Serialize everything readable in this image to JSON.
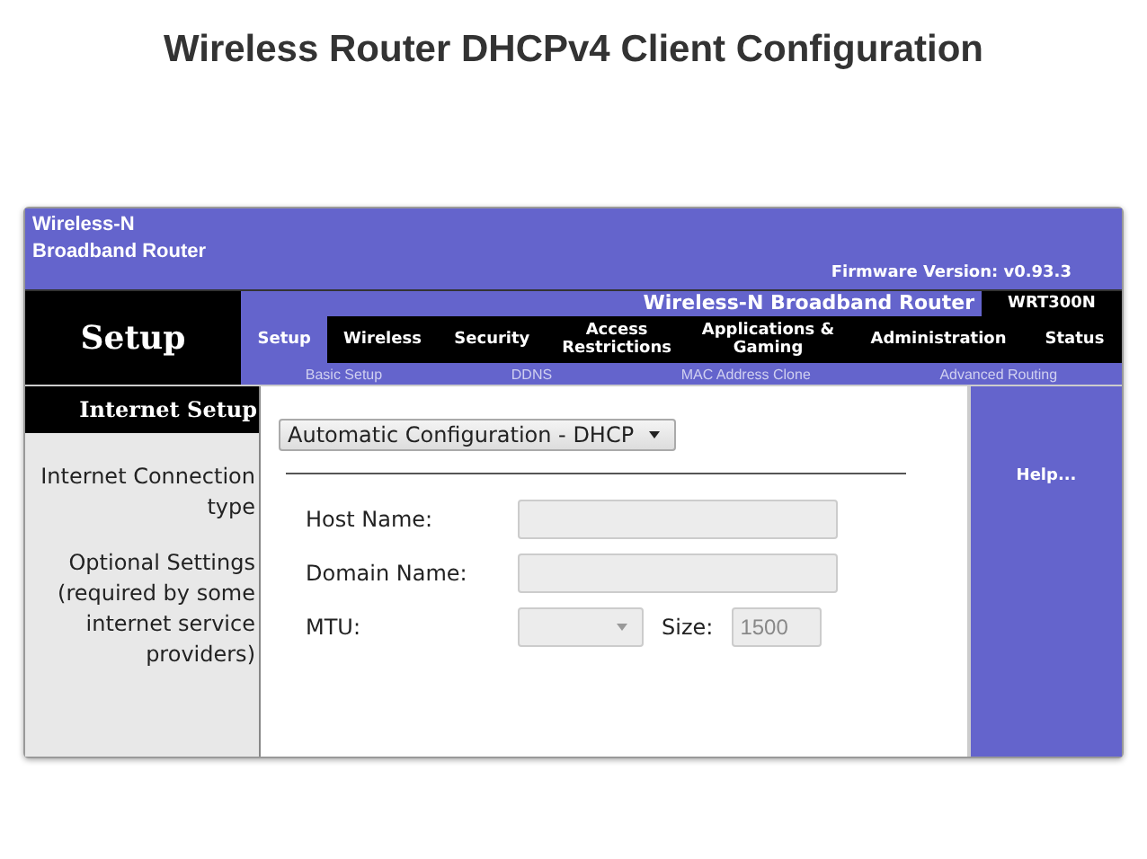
{
  "page_title": "Wireless Router DHCPv4 Client Configuration",
  "router": {
    "brand_lines": [
      "Wireless-N",
      "Broadband Router"
    ],
    "firmware": "Firmware Version: v0.93.3",
    "section": "Setup",
    "product_name": "Wireless-N Broadband Router",
    "model": "WRT300N",
    "tabs": [
      {
        "label": "Setup",
        "selected": true
      },
      {
        "label": "Wireless",
        "selected": false
      },
      {
        "label": "Security",
        "selected": false
      },
      {
        "label": "Access Restrictions",
        "selected": false
      },
      {
        "label": "Applications & Gaming",
        "selected": false
      },
      {
        "label": "Administration",
        "selected": false
      },
      {
        "label": "Status",
        "selected": false
      }
    ],
    "subtabs": [
      "Basic Setup",
      "DDNS",
      "MAC Address Clone",
      "Advanced Routing"
    ],
    "sidebar": {
      "heading": "Internet Setup",
      "labels": [
        "Internet Connection type",
        "Optional Settings (required by some internet service providers)"
      ]
    },
    "connection_type": "Automatic Configuration - DHCP",
    "fields": [
      {
        "label": "Host Name:",
        "kind": "text",
        "disabled": true
      },
      {
        "label": "Domain Name:",
        "kind": "text",
        "disabled": true
      },
      {
        "label": "MTU:",
        "kind": "select",
        "disabled": true,
        "size_label": "Size:",
        "size_value": "1500"
      }
    ],
    "help": "Help..."
  }
}
